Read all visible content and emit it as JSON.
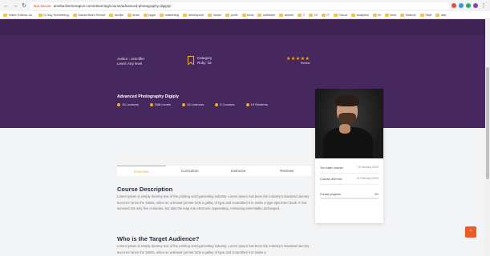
{
  "browser": {
    "secure_label": "Not secure",
    "url": "amelia.themeregion.com/elearning/course/advanced-photography-digiply/"
  },
  "bookmarks": [
    "Video Editors Ja...",
    "D Day Something",
    "Subscribers Remot",
    "media",
    "draw",
    "apps",
    "marketing",
    "developers",
    "music",
    "profit",
    "tools",
    "software",
    "assets",
    "Y",
    "UI",
    "IT",
    "Cloud",
    "analytics",
    "M",
    "links",
    "finance",
    "Stuff",
    "ads"
  ],
  "hero": {
    "author_line1": "Author : Jenniffer",
    "author_line2": "Level: Any level",
    "category_line1": "Category",
    "category_line2": "Ruby '15",
    "stars": "★★★★★",
    "reviews": "Review",
    "course_title": "Advanced Photography Digiply",
    "stats": [
      "15 Lectures",
      "Skill Levels",
      "15 Learners",
      "5 Courses",
      "19 Students"
    ]
  },
  "tabs": [
    "Overview",
    "Curriculum",
    "Instructor",
    "Reviews"
  ],
  "sections": {
    "desc_title": "Course Description",
    "desc_text": "Lorem Ipsum is simply dummy text of the printing and typesetting industry. Lorem Ipsum has been the industry's standard dummy text ever since the 1500s, when an unknown printer took a galley of type and scrambled it to make a type specimen book. It has survived not only five centuries, but also the leap into electronic typesetting, remaining essentially unchanged.",
    "audience_title": "Who is the Target Audience?",
    "audience_text": "Lorem Ipsum is simply dummy text of the printing and typesetting industry. Lorem Ipsum has been the industry's standard dummy text ever since the 1500s, when an unknown printer took a galley of type and scrambled it to make a"
  },
  "card": {
    "start_label": "You start course",
    "start_value": "19 January 2020",
    "end_label": "Course will end",
    "end_value": "19 February 2020",
    "progress_label": "Course progress",
    "progress_value": "0%",
    "progress_fraction": 0
  },
  "colors": {
    "hero": "#46285e",
    "accent": "#f2b01e",
    "top_button": "#ef5b25"
  }
}
